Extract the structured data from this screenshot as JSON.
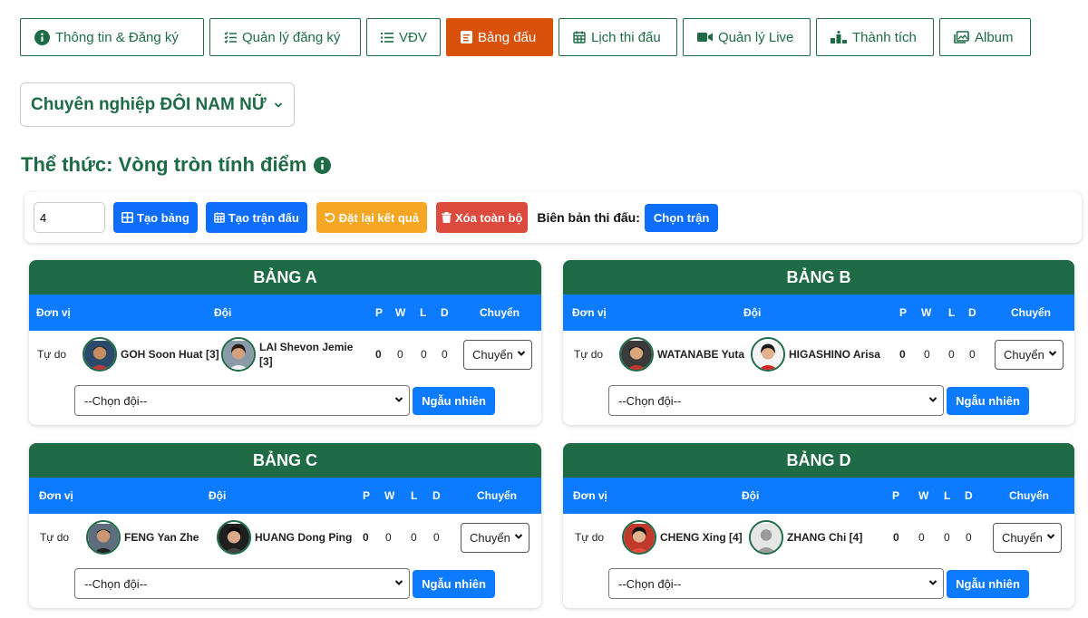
{
  "tabs": [
    {
      "label": "Thông tin & Đăng ký",
      "icon": "info-circle-icon",
      "active": false
    },
    {
      "label": "Quản lý đăng ký",
      "icon": "checklist-icon",
      "active": false
    },
    {
      "label": "VĐV",
      "icon": "list-icon",
      "active": false
    },
    {
      "label": "Bảng đấu",
      "icon": "table-icon",
      "active": true
    },
    {
      "label": "Lịch thi đấu",
      "icon": "calendar-icon",
      "active": false
    },
    {
      "label": "Quản lý Live",
      "icon": "video-icon",
      "active": false
    },
    {
      "label": "Thành tích",
      "icon": "podium-icon",
      "active": false
    },
    {
      "label": "Album",
      "icon": "image-icon",
      "active": false
    }
  ],
  "category": {
    "selected": "Chuyên nghiệp ĐÔI NAM NỮ"
  },
  "format": {
    "title": "Thể thức: Vòng tròn tính điểm"
  },
  "toolbar": {
    "group_count": "4",
    "create_groups": "Tạo bảng",
    "create_matches": "Tạo trận đấu",
    "reset_results": "Đặt lại kết quả",
    "delete_all": "Xóa toàn bộ",
    "record_label": "Biên bản thi đấu:",
    "choose_match": "Chọn trận"
  },
  "columns": {
    "unit": "Đơn vị",
    "team": "Đội",
    "p": "P",
    "w": "W",
    "l": "L",
    "d": "D",
    "move": "Chuyển"
  },
  "groups": [
    {
      "name": "BẢNG A",
      "unit": "Tự do",
      "player1": "GOH Soon Huat [3]",
      "player2": "LAI Shevon Jemie [3]",
      "p": "0",
      "w": "0",
      "l": "0",
      "d": "0",
      "move": "Chuyển",
      "team_placeholder": "--Chọn đội--",
      "random": "Ngẫu nhiên"
    },
    {
      "name": "BẢNG B",
      "unit": "Tự do",
      "player1": "WATANABE Yuta",
      "player2": "HIGASHINO Arisa",
      "p": "0",
      "w": "0",
      "l": "0",
      "d": "0",
      "move": "Chuyển",
      "team_placeholder": "--Chọn đội--",
      "random": "Ngẫu nhiên"
    },
    {
      "name": "BẢNG C",
      "unit": "Tự do",
      "player1": "FENG Yan Zhe",
      "player2": "HUANG Dong Ping",
      "p": "0",
      "w": "0",
      "l": "0",
      "d": "0",
      "move": "Chuyển",
      "team_placeholder": "--Chọn đội--",
      "random": "Ngẫu nhiên"
    },
    {
      "name": "BẢNG D",
      "unit": "Tự do",
      "player1": "CHENG Xing [4]",
      "player2": "ZHANG Chi [4]",
      "p": "0",
      "w": "0",
      "l": "0",
      "d": "0",
      "move": "Chuyển",
      "team_placeholder": "--Chọn đội--",
      "random": "Ngẫu nhiên"
    }
  ],
  "colors": {
    "primary_green": "#1e6b46",
    "active_tab": "#d9520b",
    "blue": "#0d7bff",
    "yellow": "#f5a623",
    "red": "#dc4b3e"
  }
}
